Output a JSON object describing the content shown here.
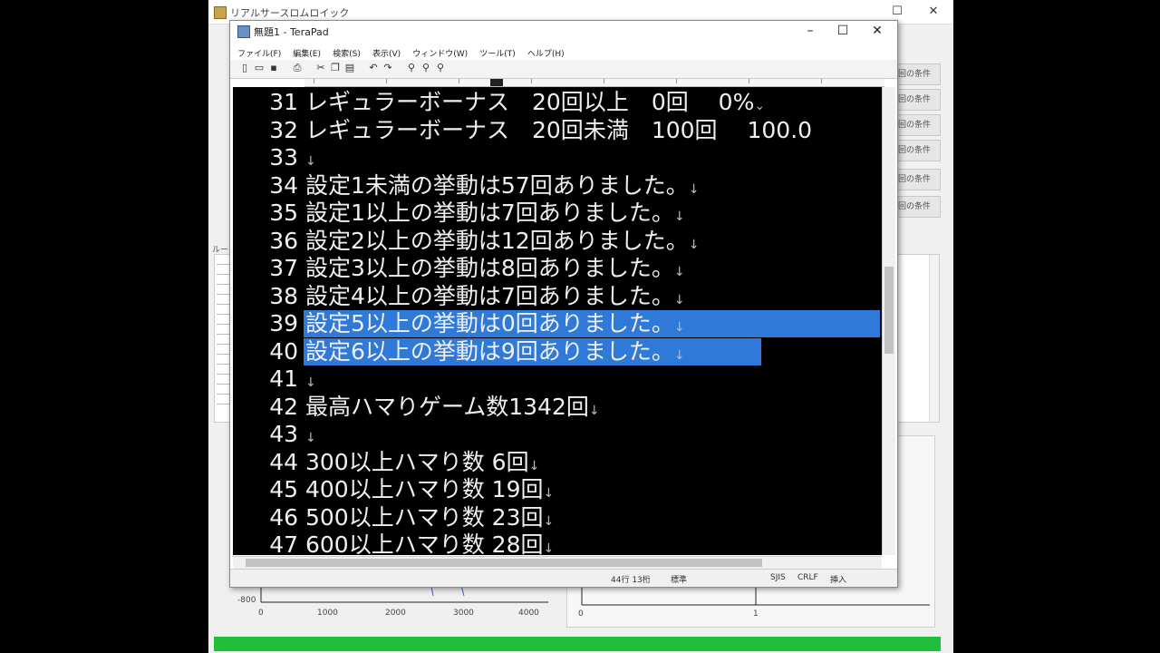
{
  "background_window": {
    "title": "リアルサースロムロイック",
    "side_buttons": [
      "回の条件",
      "回の条件",
      "回の条件",
      "回の条件",
      "回の条件",
      "回の条件"
    ],
    "left_label": "ルート",
    "chart_left_ticks": [
      "0",
      "1000",
      "2000",
      "3000",
      "4000"
    ],
    "chart_left_y": "-800",
    "chart_right_ticks": [
      "0",
      "1"
    ]
  },
  "editor": {
    "title": "無題1 - TeraPad",
    "controls": {
      "minimize": "–",
      "maximize": "☐",
      "close": "✕"
    },
    "menu": [
      "ファイル(F)",
      "編集(E)",
      "検索(S)",
      "表示(V)",
      "ウィンドウ(W)",
      "ツール(T)",
      "ヘルプ(H)"
    ],
    "toolbar_icons": [
      "new-icon",
      "open-icon",
      "save-icon",
      "print-icon",
      "cut-icon",
      "copy-icon",
      "paste-icon",
      "undo-icon",
      "redo-icon",
      "find-icon",
      "find-next-icon",
      "replace-icon"
    ],
    "lines": [
      {
        "num": "31",
        "text": "レギュラーボーナス　20回以上　0回　 0%",
        "eol": "⌄",
        "selected": false
      },
      {
        "num": "32",
        "text": "レギュラーボーナス　20回未満　100回　 100.0",
        "eol": "",
        "selected": false
      },
      {
        "num": "33",
        "text": "",
        "eol": "↓",
        "selected": false
      },
      {
        "num": "34",
        "text": "設定1未満の挙動は57回ありました。",
        "eol": "↓",
        "selected": false
      },
      {
        "num": "35",
        "text": "設定1以上の挙動は7回ありました。",
        "eol": "↓",
        "selected": false
      },
      {
        "num": "36",
        "text": "設定2以上の挙動は12回ありました。",
        "eol": "↓",
        "selected": false
      },
      {
        "num": "37",
        "text": "設定3以上の挙動は8回ありました。",
        "eol": "↓",
        "selected": false
      },
      {
        "num": "38",
        "text": "設定4以上の挙動は7回ありました。",
        "eol": "↓",
        "selected": false
      },
      {
        "num": "39",
        "text": "設定5以上の挙動は0回ありました。",
        "eol": "↓",
        "selected": true
      },
      {
        "num": "40",
        "text": "設定6以上の挙動は9回ありました。",
        "eol": "↓",
        "selected": true
      },
      {
        "num": "41",
        "text": "",
        "eol": "↓",
        "selected": false
      },
      {
        "num": "42",
        "text": "最高ハマりゲーム数1342回",
        "eol": "↓",
        "selected": false
      },
      {
        "num": "43",
        "text": "",
        "eol": "↓",
        "selected": false
      },
      {
        "num": "44",
        "text": "300以上ハマり数 6回",
        "eol": "↓",
        "selected": false
      },
      {
        "num": "45",
        "text": "400以上ハマり数 19回",
        "eol": "↓",
        "selected": false
      },
      {
        "num": "46",
        "text": "500以上ハマり数 23回",
        "eol": "↓",
        "selected": false
      },
      {
        "num": "47",
        "text": "600以上ハマり数 28回",
        "eol": "↓",
        "selected": false
      }
    ],
    "status": {
      "pos": "44行 13桁",
      "encoding": "標準",
      "mode1": "SJIS",
      "mode2": "CRLF",
      "insert": "挿入"
    }
  }
}
